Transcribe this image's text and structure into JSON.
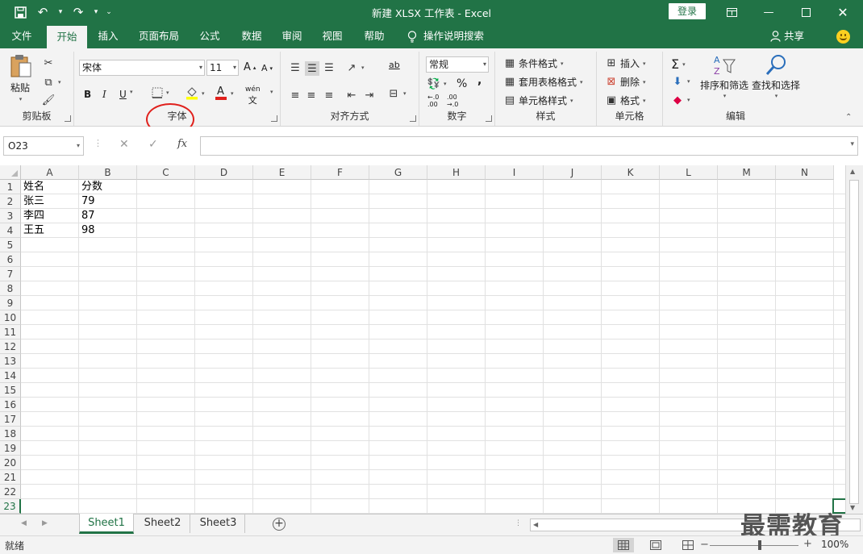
{
  "window": {
    "title": "新建 XLSX 工作表 - Excel",
    "login_label": "登录"
  },
  "tabs": [
    {
      "label": "文件",
      "active": false
    },
    {
      "label": "开始",
      "active": true
    },
    {
      "label": "插入",
      "active": false
    },
    {
      "label": "页面布局",
      "active": false
    },
    {
      "label": "公式",
      "active": false
    },
    {
      "label": "数据",
      "active": false
    },
    {
      "label": "审阅",
      "active": false
    },
    {
      "label": "视图",
      "active": false
    },
    {
      "label": "帮助",
      "active": false
    }
  ],
  "tell_me": "操作说明搜索",
  "share": "共享",
  "ribbon": {
    "clipboard": {
      "label": "剪贴板",
      "paste": "粘贴"
    },
    "font": {
      "label": "字体",
      "font_name": "宋体",
      "font_size": "11",
      "bold": "B",
      "italic": "I",
      "underline": "U",
      "grow": "A",
      "shrink": "A",
      "phonetic": "wén",
      "font_color_glyph": "A"
    },
    "alignment": {
      "label": "对齐方式",
      "wrap_glyph": "ab"
    },
    "number": {
      "label": "数字",
      "format": "常规",
      "percent": "%",
      "comma": ","
    },
    "styles": {
      "label": "样式",
      "conditional": "条件格式",
      "table": "套用表格格式",
      "cell_styles": "单元格样式"
    },
    "cells": {
      "label": "单元格",
      "insert": "插入",
      "delete": "删除",
      "format": "格式"
    },
    "editing": {
      "label": "编辑",
      "sort": "排序和筛选",
      "find": "查找和选择"
    }
  },
  "formula_bar": {
    "name_box": "O23",
    "fx": "fx",
    "value": ""
  },
  "columns": [
    "A",
    "B",
    "C",
    "D",
    "E",
    "F",
    "G",
    "H",
    "I",
    "J",
    "K",
    "L",
    "M",
    "N"
  ],
  "rows": [
    "1",
    "2",
    "3",
    "4",
    "5",
    "6",
    "7",
    "8",
    "9",
    "10",
    "11",
    "12",
    "13",
    "14",
    "15",
    "16",
    "17",
    "18",
    "19",
    "20",
    "21",
    "22",
    "23"
  ],
  "selected_row": "23",
  "cells": [
    {
      "ref": "A1",
      "value": "姓名"
    },
    {
      "ref": "B1",
      "value": "分数"
    },
    {
      "ref": "A2",
      "value": "张三"
    },
    {
      "ref": "B2",
      "value": "79"
    },
    {
      "ref": "A3",
      "value": "李四"
    },
    {
      "ref": "B3",
      "value": "87"
    },
    {
      "ref": "A4",
      "value": "王五"
    },
    {
      "ref": "B4",
      "value": "98"
    }
  ],
  "sheets": [
    {
      "name": "Sheet1",
      "active": true
    },
    {
      "name": "Sheet2",
      "active": false
    },
    {
      "name": "Sheet3",
      "active": false
    }
  ],
  "status": {
    "mode": "就绪",
    "zoom": "100%"
  },
  "watermark": "最需教育",
  "colors": {
    "accent": "#217346",
    "highlight_circle": "#e0201c"
  }
}
